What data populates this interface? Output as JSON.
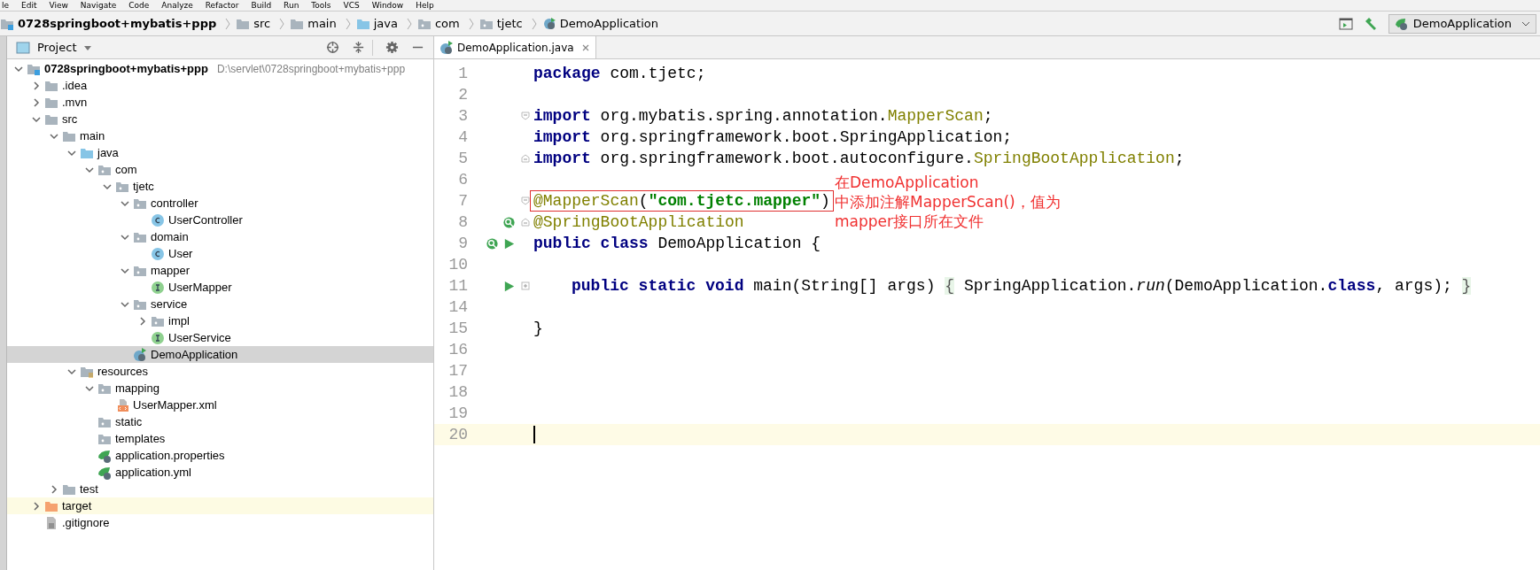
{
  "menu": [
    "le",
    "Edit",
    "View",
    "Navigate",
    "Code",
    "Analyze",
    "Refactor",
    "Build",
    "Run",
    "Tools",
    "VCS",
    "Window",
    "Help"
  ],
  "breadcrumb": [
    {
      "label": "0728springboot+mybatis+ppp",
      "kind": "module"
    },
    {
      "label": "src",
      "kind": "folder"
    },
    {
      "label": "main",
      "kind": "folder"
    },
    {
      "label": "java",
      "kind": "source-folder"
    },
    {
      "label": "com",
      "kind": "package"
    },
    {
      "label": "tjetc",
      "kind": "package"
    },
    {
      "label": "DemoApplication",
      "kind": "spring-app"
    }
  ],
  "run_config": {
    "label": "DemoApplication"
  },
  "project_panel": {
    "title": "Project",
    "tree": [
      {
        "label": "0728springboot+mybatis+ppp",
        "path": "D:\\servlet\\0728springboot+mybatis+ppp",
        "kind": "module",
        "expanded": true,
        "selected": false,
        "children": [
          {
            "label": ".idea",
            "kind": "folder",
            "expanded": false,
            "selected": false
          },
          {
            "label": ".mvn",
            "kind": "folder",
            "expanded": false,
            "selected": false
          },
          {
            "label": "src",
            "kind": "folder",
            "expanded": true,
            "selected": false,
            "children": [
              {
                "label": "main",
                "kind": "folder",
                "expanded": true,
                "selected": false,
                "children": [
                  {
                    "label": "java",
                    "kind": "source-folder",
                    "expanded": true,
                    "selected": false,
                    "children": [
                      {
                        "label": "com",
                        "kind": "package",
                        "expanded": true,
                        "selected": false,
                        "children": [
                          {
                            "label": "tjetc",
                            "kind": "package",
                            "expanded": true,
                            "selected": false,
                            "children": [
                              {
                                "label": "controller",
                                "kind": "package",
                                "expanded": true,
                                "selected": false,
                                "children": [
                                  {
                                    "label": "UserController",
                                    "kind": "class",
                                    "selected": false
                                  }
                                ]
                              },
                              {
                                "label": "domain",
                                "kind": "package",
                                "expanded": true,
                                "selected": false,
                                "children": [
                                  {
                                    "label": "User",
                                    "kind": "class",
                                    "selected": false
                                  }
                                ]
                              },
                              {
                                "label": "mapper",
                                "kind": "package",
                                "expanded": true,
                                "selected": false,
                                "children": [
                                  {
                                    "label": "UserMapper",
                                    "kind": "interface",
                                    "selected": false
                                  }
                                ]
                              },
                              {
                                "label": "service",
                                "kind": "package",
                                "expanded": true,
                                "selected": false,
                                "children": [
                                  {
                                    "label": "impl",
                                    "kind": "package",
                                    "expanded": false,
                                    "selected": false
                                  },
                                  {
                                    "label": "UserService",
                                    "kind": "interface",
                                    "selected": false
                                  }
                                ]
                              },
                              {
                                "label": "DemoApplication",
                                "kind": "spring-app",
                                "selected": true
                              }
                            ]
                          }
                        ]
                      }
                    ]
                  },
                  {
                    "label": "resources",
                    "kind": "resources-folder",
                    "expanded": true,
                    "selected": false,
                    "children": [
                      {
                        "label": "mapping",
                        "kind": "package",
                        "expanded": true,
                        "selected": false,
                        "children": [
                          {
                            "label": "UserMapper.xml",
                            "kind": "xml",
                            "selected": false
                          }
                        ]
                      },
                      {
                        "label": "static",
                        "kind": "package",
                        "selected": false
                      },
                      {
                        "label": "templates",
                        "kind": "package",
                        "selected": false
                      },
                      {
                        "label": "application.properties",
                        "kind": "spring-config",
                        "selected": false
                      },
                      {
                        "label": "application.yml",
                        "kind": "spring-config",
                        "selected": false
                      }
                    ]
                  }
                ]
              },
              {
                "label": "test",
                "kind": "folder",
                "expanded": false,
                "selected": false
              }
            ]
          },
          {
            "label": "target",
            "kind": "excluded-folder",
            "expanded": false,
            "selected": false
          },
          {
            "label": ".gitignore",
            "kind": "file",
            "selected": false
          }
        ]
      }
    ]
  },
  "editor": {
    "tab": {
      "label": "DemoApplication.java",
      "selected": true
    },
    "lines": [
      {
        "number": "1",
        "current": false,
        "boxed": false,
        "tokens": [
          {
            "kind": "keyword",
            "text": "package"
          },
          {
            "kind": "plain",
            "text": " com.tjetc;"
          }
        ]
      },
      {
        "number": "2",
        "current": false
      },
      {
        "number": "3",
        "current": false,
        "boxed": false,
        "fold": {
          "kind": "start"
        },
        "tokens": [
          {
            "kind": "keyword",
            "text": "import"
          },
          {
            "kind": "plain",
            "text": " org.mybatis.spring.annotation."
          },
          {
            "kind": "annotation",
            "text": "MapperScan"
          },
          {
            "kind": "plain",
            "text": ";"
          }
        ]
      },
      {
        "number": "4",
        "current": false,
        "boxed": false,
        "tokens": [
          {
            "kind": "keyword",
            "text": "import"
          },
          {
            "kind": "plain",
            "text": " org.springframework.boot.SpringApplication;"
          }
        ]
      },
      {
        "number": "5",
        "current": false,
        "boxed": false,
        "fold": {
          "kind": "end"
        },
        "tokens": [
          {
            "kind": "keyword",
            "text": "import"
          },
          {
            "kind": "plain",
            "text": " org.springframework.boot.autoconfigure."
          },
          {
            "kind": "annotation",
            "text": "SpringBootApplication"
          },
          {
            "kind": "plain",
            "text": ";"
          }
        ]
      },
      {
        "number": "6",
        "current": false
      },
      {
        "number": "7",
        "current": false,
        "boxed": true,
        "fold": {
          "kind": "start"
        },
        "tokens": [
          {
            "kind": "annotation",
            "text": "@MapperScan"
          },
          {
            "kind": "plain",
            "text": "("
          },
          {
            "kind": "string",
            "text": "\"com.tjetc.mapper\""
          },
          {
            "kind": "plain",
            "text": ")"
          }
        ]
      },
      {
        "number": "8",
        "current": false,
        "boxed": false,
        "gutter": [
          {
            "kind": "bean"
          }
        ],
        "fold": {
          "kind": "end"
        },
        "tokens": [
          {
            "kind": "annotation",
            "text": "@SpringBootApplication"
          }
        ]
      },
      {
        "number": "9",
        "current": false,
        "boxed": false,
        "gutter": [
          {
            "kind": "bean"
          },
          {
            "kind": "run"
          }
        ],
        "tokens": [
          {
            "kind": "keyword",
            "text": "public class"
          },
          {
            "kind": "plain",
            "text": " DemoApplication {"
          }
        ]
      },
      {
        "number": "10",
        "current": false
      },
      {
        "number": "11",
        "current": false,
        "boxed": false,
        "gutter": [
          {
            "kind": "run"
          }
        ],
        "fold": {
          "kind": "collapsed"
        },
        "indented": true,
        "tokens": [
          {
            "kind": "keyword",
            "text": "public static void"
          },
          {
            "kind": "plain",
            "text": " main(String[] args) "
          },
          {
            "kind": "folded",
            "text": "{"
          },
          {
            "kind": "plain",
            "text": " SpringApplication."
          },
          {
            "kind": "italic",
            "text": "run"
          },
          {
            "kind": "plain",
            "text": "(DemoApplication."
          },
          {
            "kind": "keyword",
            "text": "class"
          },
          {
            "kind": "plain",
            "text": ", args); "
          },
          {
            "kind": "folded",
            "text": "}"
          }
        ]
      },
      {
        "number": "14",
        "current": false
      },
      {
        "number": "15",
        "current": false,
        "boxed": false,
        "tokens": [
          {
            "kind": "plain",
            "text": "}"
          }
        ]
      },
      {
        "number": "16",
        "current": false
      },
      {
        "number": "17",
        "current": false
      },
      {
        "number": "18",
        "current": false
      },
      {
        "number": "19",
        "current": false
      },
      {
        "number": "20",
        "current": true
      }
    ]
  },
  "note": {
    "lines": [
      "在DemoApplication",
      "中添加注解MapperScan()，值为",
      "mapper接口所在文件"
    ]
  }
}
